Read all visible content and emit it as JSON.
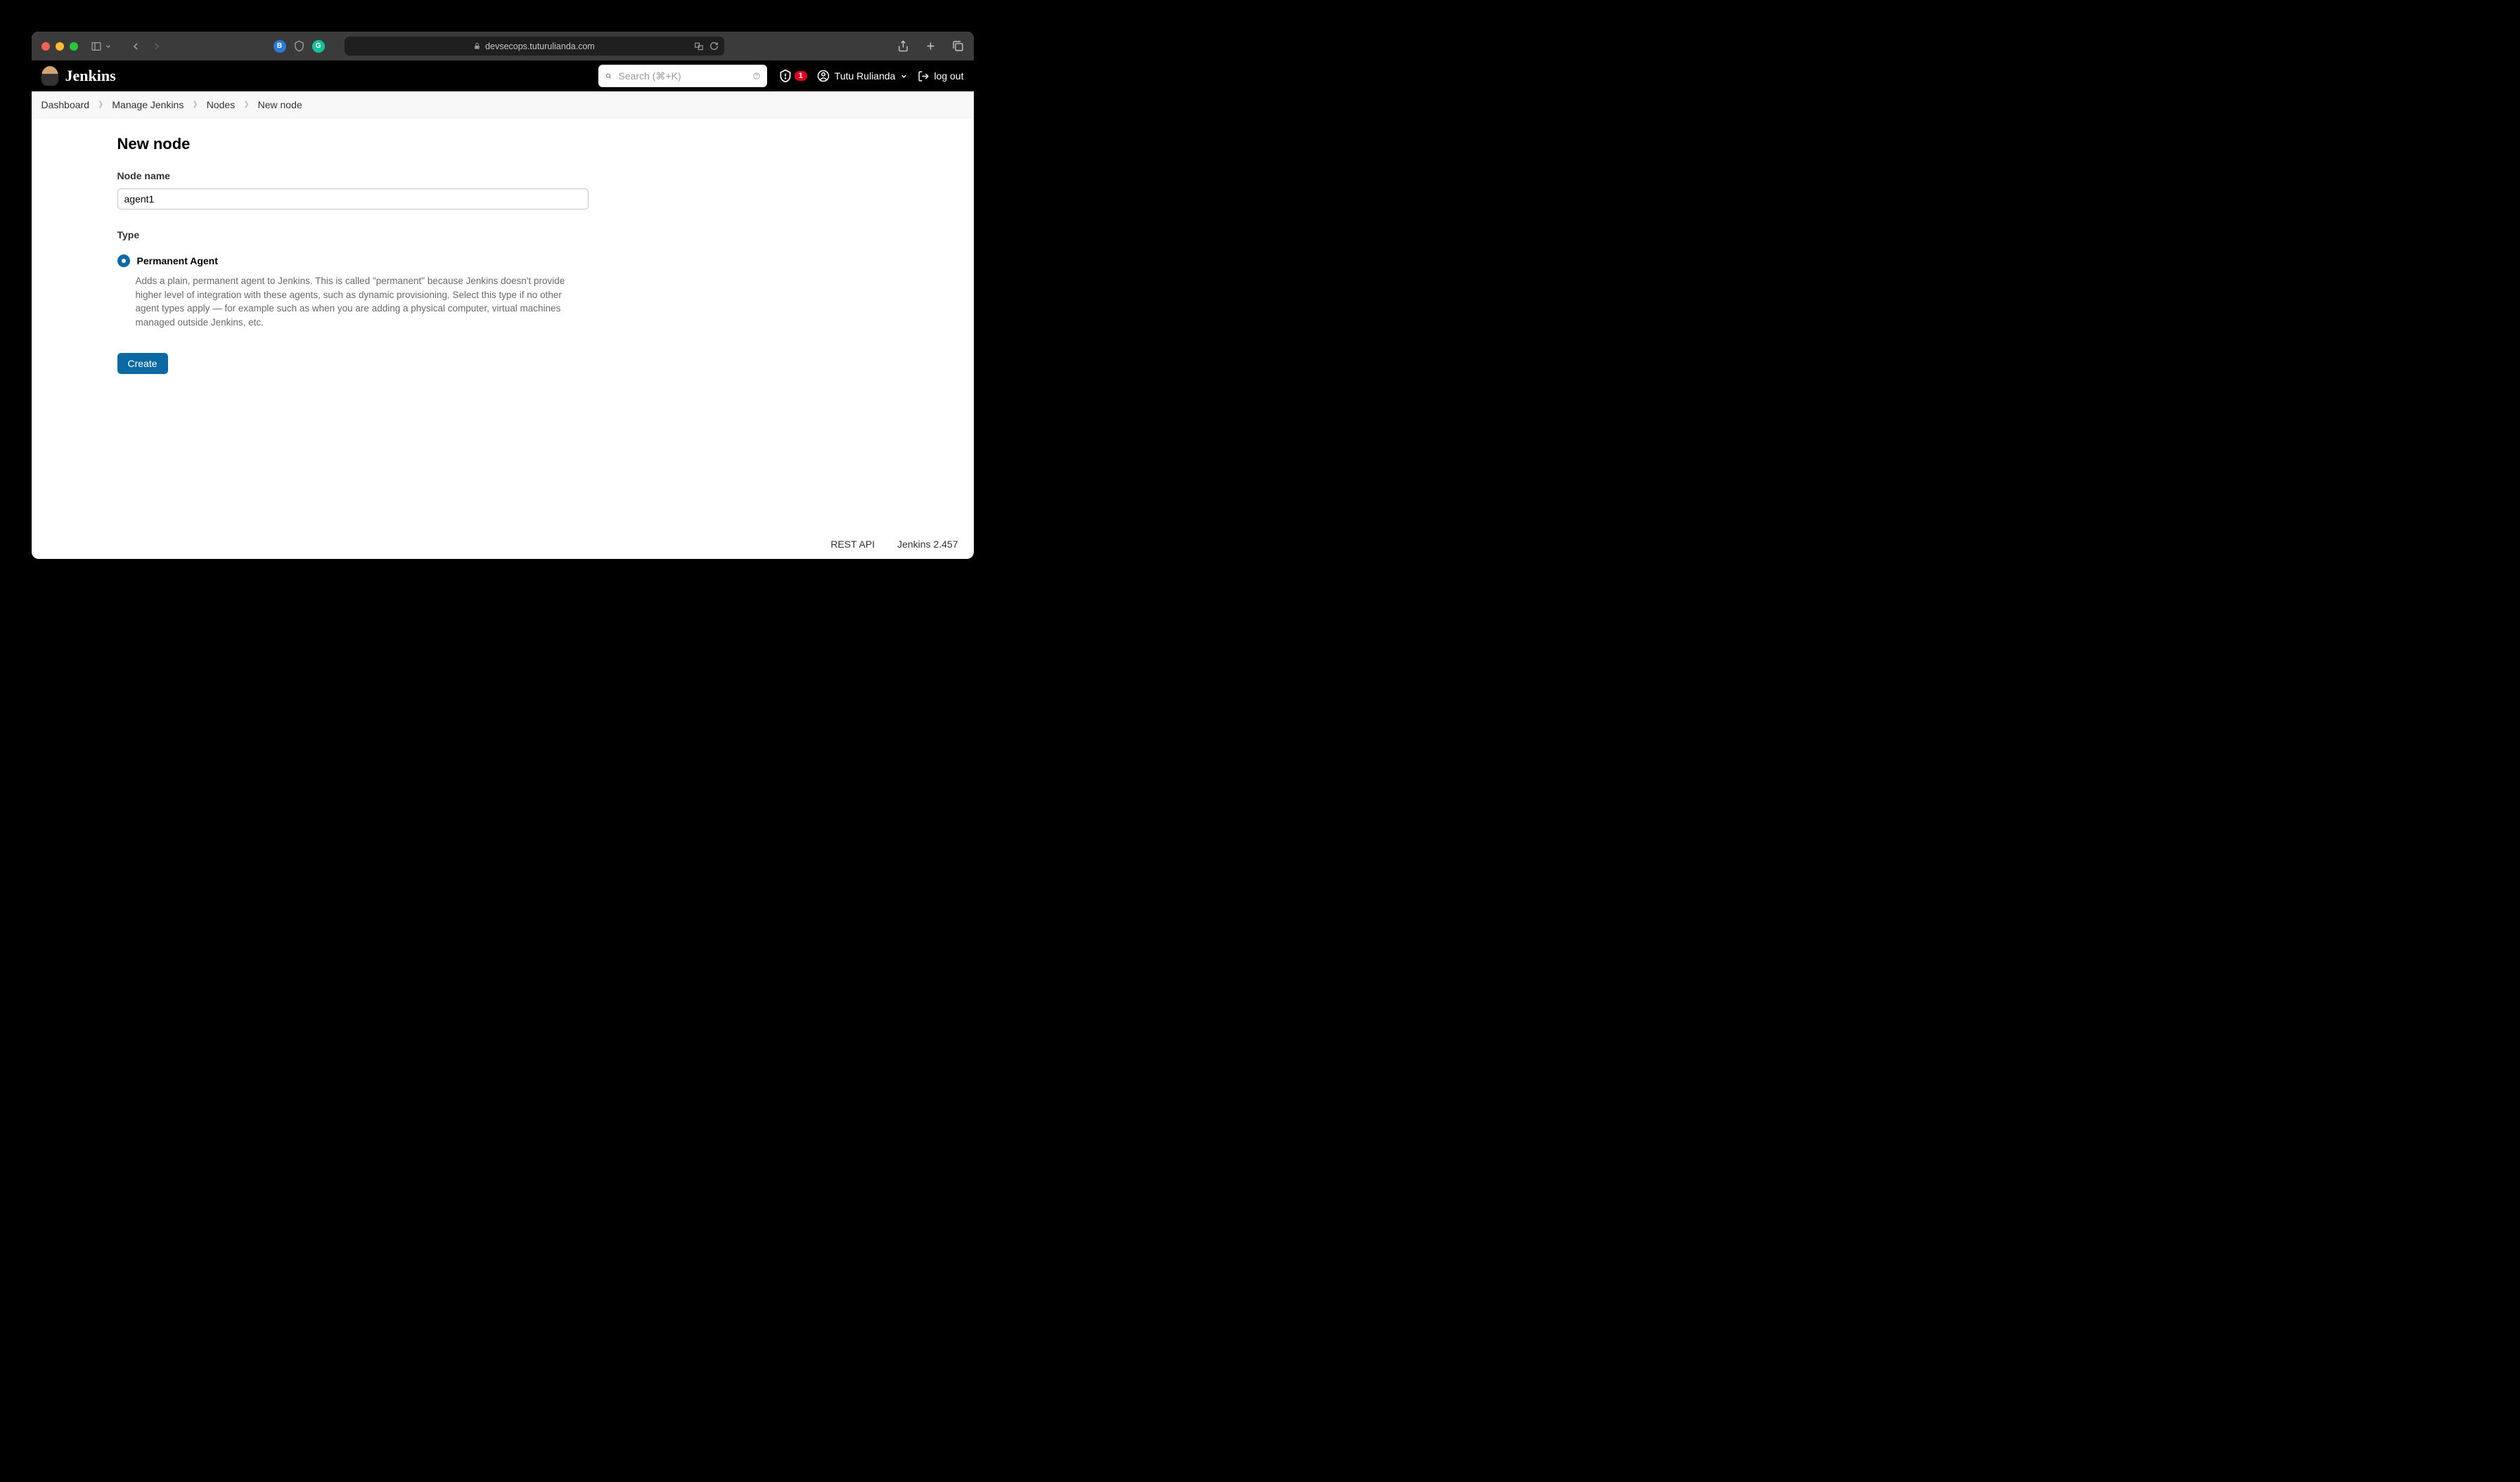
{
  "browser": {
    "url_host": "devsecops.tuturulianda.com"
  },
  "header": {
    "app_name": "Jenkins",
    "search_placeholder": "Search (⌘+K)",
    "alert_count": "1",
    "user_name": "Tutu Rulianda",
    "logout_label": "log out"
  },
  "breadcrumbs": [
    "Dashboard",
    "Manage Jenkins",
    "Nodes",
    "New node"
  ],
  "page": {
    "title": "New node",
    "node_name_label": "Node name",
    "node_name_value": "agent1",
    "type_label": "Type",
    "radio_option_label": "Permanent Agent",
    "radio_option_desc": "Adds a plain, permanent agent to Jenkins. This is called \"permanent\" because Jenkins doesn't provide higher level of integration with these agents, such as dynamic provisioning. Select this type if no other agent types apply — for example such as when you are adding a physical computer, virtual machines managed outside Jenkins, etc.",
    "create_button": "Create"
  },
  "footer": {
    "rest_api": "REST API",
    "version": "Jenkins 2.457"
  }
}
